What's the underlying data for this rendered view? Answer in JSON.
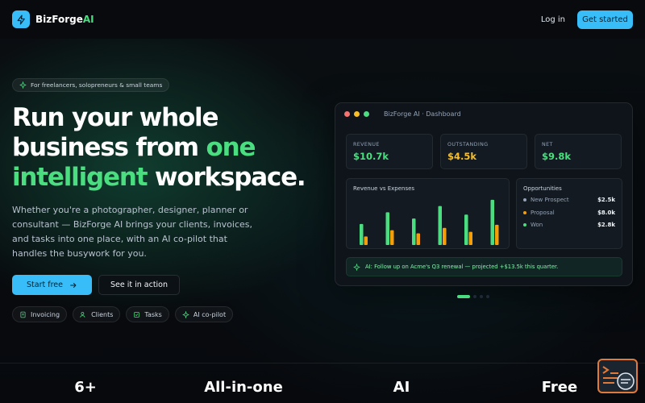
{
  "header": {
    "brand_main": "BizForge",
    "brand_accent": "AI",
    "login_label": "Log in",
    "cta_label": "Get started"
  },
  "hero": {
    "pill_text": "For freelancers, solopreneurs & small teams",
    "headline_part1": "Run your whole business from ",
    "headline_accent": "one intelligent",
    "headline_part2": " workspace.",
    "description": "Whether you're a photographer, designer, planner or consultant — BizForge AI brings your clients, invoices, and tasks into one place, with an AI co-pilot that handles the busywork for you.",
    "primary_button": "Start free",
    "secondary_button": "See it in action",
    "chips": [
      "Invoicing",
      "Clients",
      "Tasks",
      "AI co-pilot"
    ]
  },
  "dashboard": {
    "title": "BizForge AI · Dashboard",
    "stats": [
      {
        "label": "REVENUE",
        "value": "$10.7k",
        "color": "#4ade80"
      },
      {
        "label": "OUTSTANDING",
        "value": "$4.5k",
        "color": "#fbbf24"
      },
      {
        "label": "NET",
        "value": "$9.8k",
        "color": "#4ade80"
      }
    ],
    "chart_title": "Revenue vs Expenses",
    "opportunities_title": "Opportunities",
    "opportunities": [
      {
        "name": "New Prospect",
        "value": "$2.5k",
        "color": "#94a3b8"
      },
      {
        "name": "Proposal",
        "value": "$8.0k",
        "color": "#f59e0b"
      },
      {
        "name": "Won",
        "value": "$2.8k",
        "color": "#4ade80"
      }
    ],
    "ai_message": "AI: Follow up on Acme's Q3 renewal — projected +$13.5k this quarter."
  },
  "chart_data": {
    "type": "bar",
    "title": "Revenue vs Expenses",
    "categories": [
      "",
      "",
      "",
      "",
      "",
      ""
    ],
    "series": [
      {
        "values": [
          27,
          42,
          34,
          50,
          39,
          58
        ]
      },
      {
        "values": [
          11,
          19,
          15,
          22,
          17,
          26
        ]
      }
    ],
    "ylim": [
      0,
      60
    ],
    "grid": false,
    "colors": [
      "#4ade80",
      "#f59e0b"
    ]
  },
  "stats_strip": [
    "6+",
    "All-in-one",
    "AI",
    "Free"
  ],
  "colors": {
    "accent_blue": "#38bdf8",
    "accent_green": "#4ade80",
    "accent_amber": "#f59e0b",
    "background": "#07090d"
  },
  "icons": {
    "logo": "bolt-icon",
    "pill": "sparkle-icon",
    "primary_button": "arrow-right-icon",
    "chips": [
      "invoice-icon",
      "users-icon",
      "tasks-icon",
      "sparkle-icon"
    ],
    "ai_bar": "sparkle-icon",
    "widget": "terminal-chat-icon"
  }
}
